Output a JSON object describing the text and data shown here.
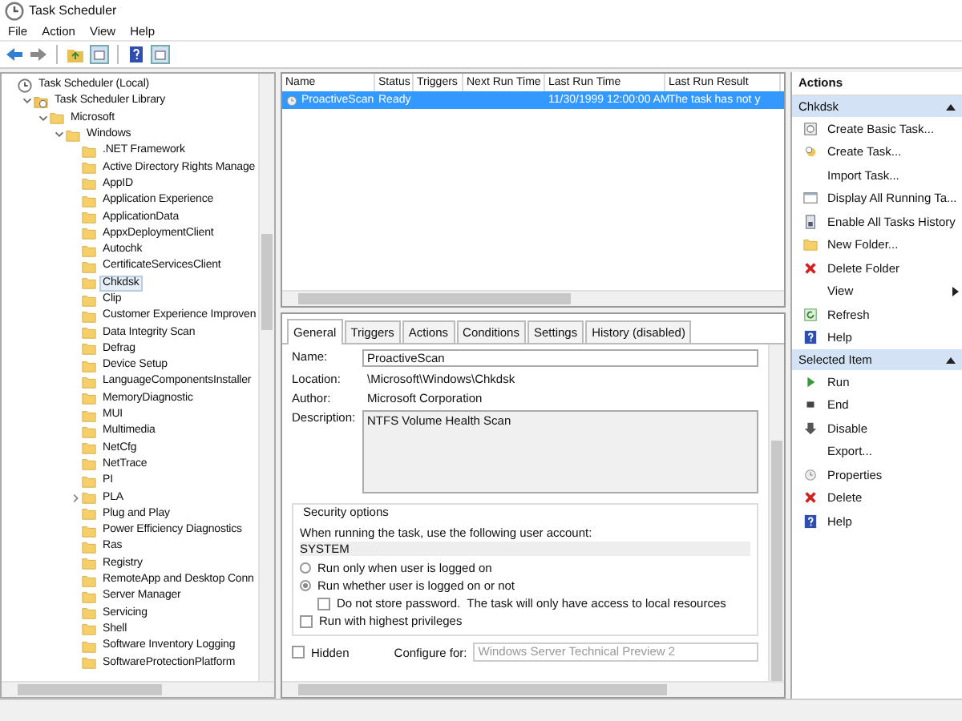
{
  "window": {
    "title": "Task Scheduler"
  },
  "menu": [
    "File",
    "Action",
    "View",
    "Help"
  ],
  "tree": [
    {
      "label": "Task Scheduler (Local)",
      "selected": false,
      "children": [
        {
          "label": "Task Scheduler Library",
          "selected": false,
          "expanded": true,
          "children": [
            {
              "label": "Microsoft",
              "selected": false,
              "expanded": true,
              "children": [
                {
                  "label": "Windows",
                  "selected": false,
                  "expanded": true,
                  "children": [
                    {
                      "label": ".NET Framework",
                      "selected": false
                    },
                    {
                      "label": "Active Directory Rights Manage",
                      "selected": false
                    },
                    {
                      "label": "AppID",
                      "selected": false
                    },
                    {
                      "label": "Application Experience",
                      "selected": false
                    },
                    {
                      "label": "ApplicationData",
                      "selected": false
                    },
                    {
                      "label": "AppxDeploymentClient",
                      "selected": false
                    },
                    {
                      "label": "Autochk",
                      "selected": false
                    },
                    {
                      "label": "CertificateServicesClient",
                      "selected": false
                    },
                    {
                      "label": "Chkdsk",
                      "selected": true
                    },
                    {
                      "label": "Clip",
                      "selected": false
                    },
                    {
                      "label": "Customer Experience Improven",
                      "selected": false
                    },
                    {
                      "label": "Data Integrity Scan",
                      "selected": false
                    },
                    {
                      "label": "Defrag",
                      "selected": false
                    },
                    {
                      "label": "Device Setup",
                      "selected": false
                    },
                    {
                      "label": "LanguageComponentsInstaller",
                      "selected": false
                    },
                    {
                      "label": "MemoryDiagnostic",
                      "selected": false
                    },
                    {
                      "label": "MUI",
                      "selected": false
                    },
                    {
                      "label": "Multimedia",
                      "selected": false
                    },
                    {
                      "label": "NetCfg",
                      "selected": false
                    },
                    {
                      "label": "NetTrace",
                      "selected": false
                    },
                    {
                      "label": "PI",
                      "selected": false
                    },
                    {
                      "label": "PLA",
                      "selected": false,
                      "expanded": false
                    },
                    {
                      "label": "Plug and Play",
                      "selected": false
                    },
                    {
                      "label": "Power Efficiency Diagnostics",
                      "selected": false
                    },
                    {
                      "label": "Ras",
                      "selected": false
                    },
                    {
                      "label": "Registry",
                      "selected": false
                    },
                    {
                      "label": "RemoteApp and Desktop Conn",
                      "selected": false
                    },
                    {
                      "label": "Server Manager",
                      "selected": false
                    },
                    {
                      "label": "Servicing",
                      "selected": false
                    },
                    {
                      "label": "Shell",
                      "selected": false
                    },
                    {
                      "label": "Software Inventory Logging",
                      "selected": false
                    },
                    {
                      "label": "SoftwareProtectionPlatform",
                      "selected": false
                    }
                  ]
                }
              ]
            }
          ]
        }
      ]
    }
  ],
  "task_table": {
    "columns": [
      "Name",
      "Status",
      "Triggers",
      "Next Run Time",
      "Last Run Time",
      "Last Run Result"
    ],
    "rows": [
      {
        "name": "ProactiveScan",
        "status": "Ready",
        "last_run_time": "11/30/1999 12:00:00 AM",
        "last_run_result": "The task has not y",
        "selected": true
      }
    ]
  },
  "detail_tabs": [
    {
      "label": "General",
      "selected": true
    },
    {
      "label": "Triggers",
      "selected": false
    },
    {
      "label": "Actions",
      "selected": false
    },
    {
      "label": "Conditions",
      "selected": false
    },
    {
      "label": "Settings",
      "selected": false
    },
    {
      "label": "History (disabled)",
      "selected": false
    }
  ],
  "general": {
    "fields": [
      {
        "label": "Name:",
        "value": "ProactiveScan",
        "kind": "input"
      },
      {
        "label": "Location:",
        "value": "\\Microsoft\\Windows\\Chkdsk",
        "kind": "text"
      },
      {
        "label": "Author:",
        "value": "Microsoft Corporation",
        "kind": "text"
      },
      {
        "label": "Description:",
        "value": "NTFS Volume Health Scan",
        "kind": "textarea"
      }
    ],
    "security": {
      "title": "Security options",
      "prompt": "When running the task, use the following user account:",
      "account": "SYSTEM",
      "options": [
        {
          "label": "Run only when user is logged on",
          "selected": false
        },
        {
          "label": "Run whether user is logged on or not",
          "selected": true
        }
      ],
      "no_password": {
        "label": "Do not store password.  The task will only have access to local resources",
        "checked": false
      },
      "highest": {
        "label": "Run with highest privileges",
        "checked": false
      }
    },
    "hidden": {
      "label": "Hidden",
      "checked": false
    },
    "configure": {
      "label": "Configure for:",
      "value": "Windows Server Technical Preview 2",
      "disabled": true
    }
  },
  "actions": {
    "title": "Actions",
    "groups": [
      {
        "title": "Chkdsk",
        "expanded": true,
        "items": [
          {
            "label": "Create Basic Task..."
          },
          {
            "label": "Create Task..."
          },
          {
            "label": "Import Task..."
          },
          {
            "label": "Display All Running Ta..."
          },
          {
            "label": "Enable All Tasks History"
          },
          {
            "label": "New Folder..."
          },
          {
            "label": "Delete Folder"
          },
          {
            "label": "View",
            "submenu": true
          },
          {
            "label": "Refresh"
          },
          {
            "label": "Help"
          }
        ]
      },
      {
        "title": "Selected Item",
        "expanded": true,
        "items": [
          {
            "label": "Run"
          },
          {
            "label": "End"
          },
          {
            "label": "Disable"
          },
          {
            "label": "Export..."
          },
          {
            "label": "Properties"
          },
          {
            "label": "Delete"
          },
          {
            "label": "Help"
          }
        ]
      }
    ]
  }
}
